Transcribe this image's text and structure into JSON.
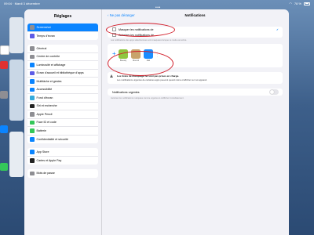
{
  "status_bar": {
    "time_date": "09:04 · Mardi 3 décembre",
    "battery": "78 %"
  },
  "sidebar": {
    "title": "Réglages",
    "groups": [
      [
        {
          "label": "Screenshot",
          "color": "#8e8e93",
          "selected": true
        },
        {
          "label": "Temps d'écran",
          "color": "#5e5ce6"
        }
      ],
      [
        {
          "label": "Général",
          "color": "#8e8e93"
        },
        {
          "label": "Centre de contrôle",
          "color": "#8e8e93"
        },
        {
          "label": "Luminosité et affichage",
          "color": "#0a84ff"
        },
        {
          "label": "Écran d'accueil et bibliothèque d'apps",
          "color": "#5e5ce6"
        },
        {
          "label": "Multitâche et gestes",
          "color": "#0a84ff"
        },
        {
          "label": "Accessibilité",
          "color": "#0a84ff"
        },
        {
          "label": "Fond d'écran",
          "color": "#34aadc"
        },
        {
          "label": "Siri et recherche",
          "color": "#222222"
        },
        {
          "label": "Apple Pencil",
          "color": "#8e8e93"
        },
        {
          "label": "Face ID et code",
          "color": "#34c759"
        },
        {
          "label": "Batterie",
          "color": "#34c759"
        },
        {
          "label": "Confidentialité et sécurité",
          "color": "#0a84ff"
        }
      ],
      [
        {
          "label": "App Store",
          "color": "#0a84ff"
        },
        {
          "label": "Cartes et Apple Pay",
          "color": "#222222"
        }
      ],
      [
        {
          "label": "Mots de passe",
          "color": "#8e8e93"
        }
      ]
    ]
  },
  "detail": {
    "back_label": "Ne pas déranger",
    "title": "Notifications",
    "options": [
      {
        "label": "Masquer les notifications de",
        "checked": true
      },
      {
        "label": "Autoriser les notifications de",
        "checked": false
      }
    ],
    "options_footer": "Les notifications des apps sélectionnées sont masquées lorsque ce mode est activé.",
    "apps": [
      {
        "label": "Bluesky",
        "color": "#8ec63f"
      },
      {
        "label": "Discord",
        "color": "#c8a36b"
      },
      {
        "label": "Mail",
        "color": "#1a8cff"
      }
    ],
    "add_icon": "plus-icon",
    "warning_title": "Les listes de masquage ne sont pas prises en charge.",
    "warning_body": "Les notifications urgentes de certaines apps peuvent quand même s'afficher sur cet appareil.",
    "urgent_label": "Notifications urgentes",
    "urgent_on": false,
    "urgent_footer": "Autoriser les notifications marquées comme urgentes à s'afficher immédiatement.",
    "annotation_color": "#d21f2b"
  }
}
